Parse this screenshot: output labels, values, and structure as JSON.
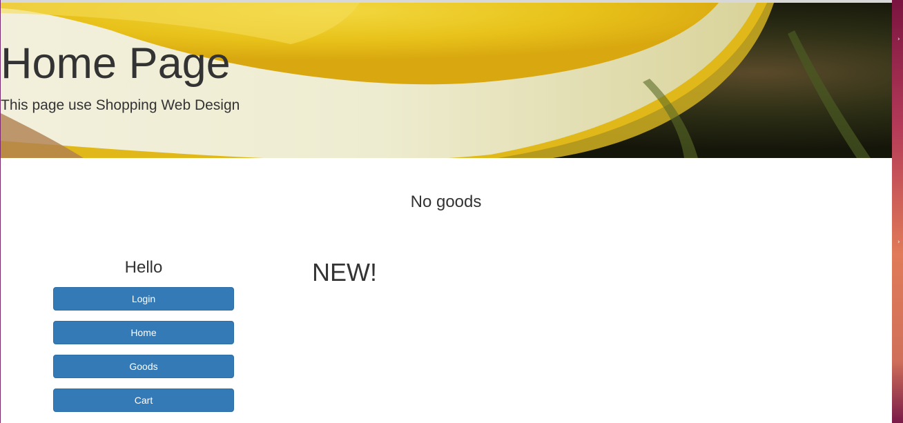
{
  "header": {
    "title": "Home Page",
    "subtitle": "This page use Shopping Web Design",
    "background": "lemon-slice-photo"
  },
  "main": {
    "status_message": "No goods"
  },
  "sidebar": {
    "greeting": "Hello",
    "buttons": [
      {
        "label": "Login"
      },
      {
        "label": "Home"
      },
      {
        "label": "Goods"
      },
      {
        "label": "Cart"
      }
    ]
  },
  "content": {
    "section_heading": "NEW!"
  },
  "colors": {
    "button_primary": "#337ab7",
    "button_border": "#2e6da4",
    "text": "#333333",
    "background": "#ffffff"
  }
}
